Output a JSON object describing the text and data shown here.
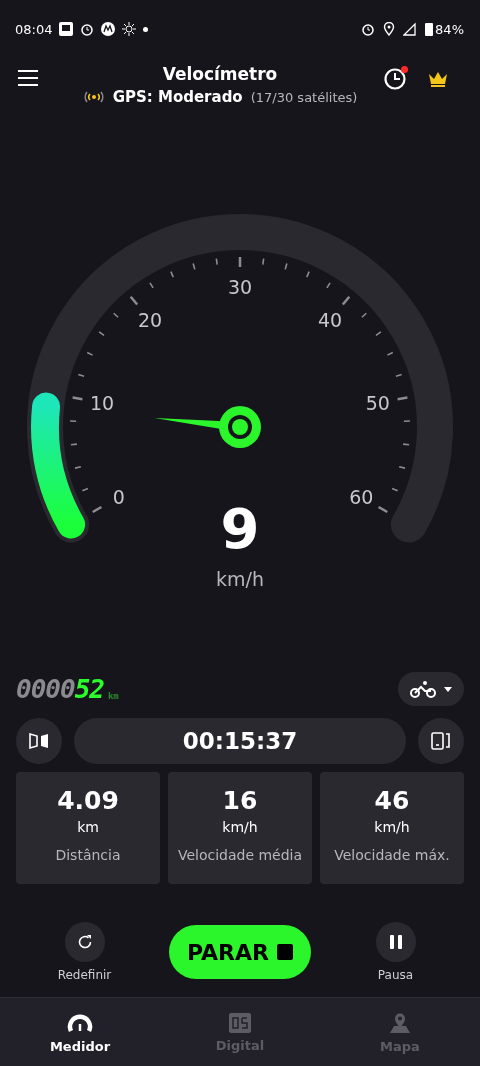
{
  "status_bar": {
    "time": "08:04",
    "battery": "84%"
  },
  "header": {
    "title": "Velocímetro",
    "gps_label": "GPS: Moderado",
    "satellites": "(17/30 satélites)",
    "notification": true
  },
  "gauge": {
    "labels": [
      "0",
      "10",
      "20",
      "30",
      "40",
      "50",
      "60"
    ],
    "speed": "9",
    "unit": "km/h"
  },
  "odometer": {
    "dim_digits": "0000",
    "digits": "52",
    "unit": "km"
  },
  "timer": "00:15:37",
  "stats": [
    {
      "value": "4.09",
      "unit": "km",
      "label": "Distância"
    },
    {
      "value": "16",
      "unit": "km/h",
      "label": "Velocidade média"
    },
    {
      "value": "46",
      "unit": "km/h",
      "label": "Velocidade máx."
    }
  ],
  "controls": {
    "reset": "Redefinir",
    "stop": "PARAR",
    "pause": "Pausa"
  },
  "nav": [
    {
      "label": "Medidor",
      "selected": true,
      "kind": "gauge"
    },
    {
      "label": "Digital",
      "selected": false,
      "kind": "digital"
    },
    {
      "label": "Mapa",
      "selected": false,
      "kind": "map"
    }
  ]
}
